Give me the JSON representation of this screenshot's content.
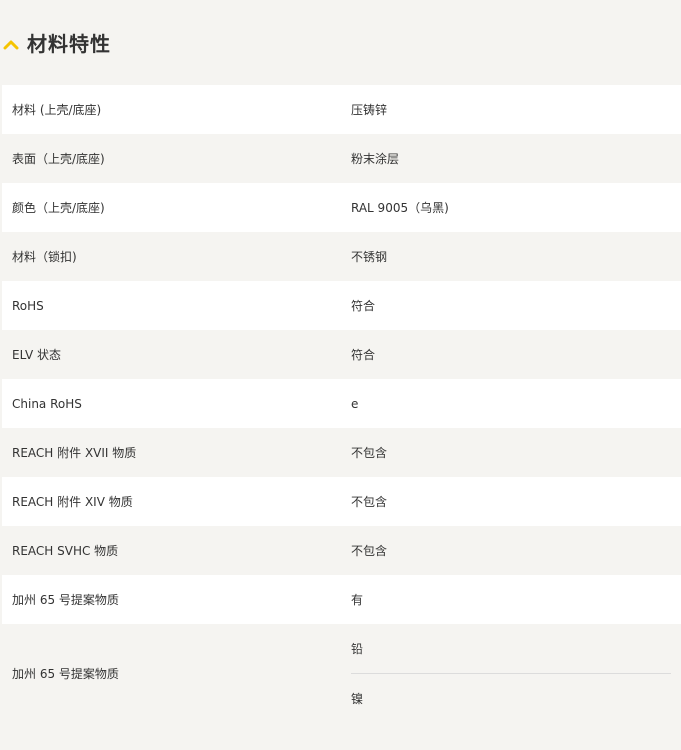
{
  "section": {
    "title": "材料特性",
    "icon": "chevron-up-icon",
    "accent_color": "#f5c400"
  },
  "rows": [
    {
      "label": "材料 (上壳/底座)",
      "value": "压铸锌"
    },
    {
      "label": "表面（上壳/底座)",
      "value": "粉末涂层"
    },
    {
      "label": "颜色（上壳/底座)",
      "value": "RAL 9005（乌黑)"
    },
    {
      "label": "材料（锁扣)",
      "value": "不锈钢"
    },
    {
      "label": "RoHS",
      "value": "符合"
    },
    {
      "label": "ELV 状态",
      "value": "符合"
    },
    {
      "label": "China RoHS",
      "value": "e"
    },
    {
      "label": "REACH 附件 XVII 物质",
      "value": "不包含"
    },
    {
      "label": "REACH 附件 XIV 物质",
      "value": "不包含"
    },
    {
      "label": "REACH SVHC 物质",
      "value": "不包含"
    },
    {
      "label": "加州 65 号提案物质",
      "value": "有"
    }
  ],
  "last_row": {
    "label": "加州 65 号提案物质",
    "values": [
      "铅",
      "镍"
    ]
  }
}
